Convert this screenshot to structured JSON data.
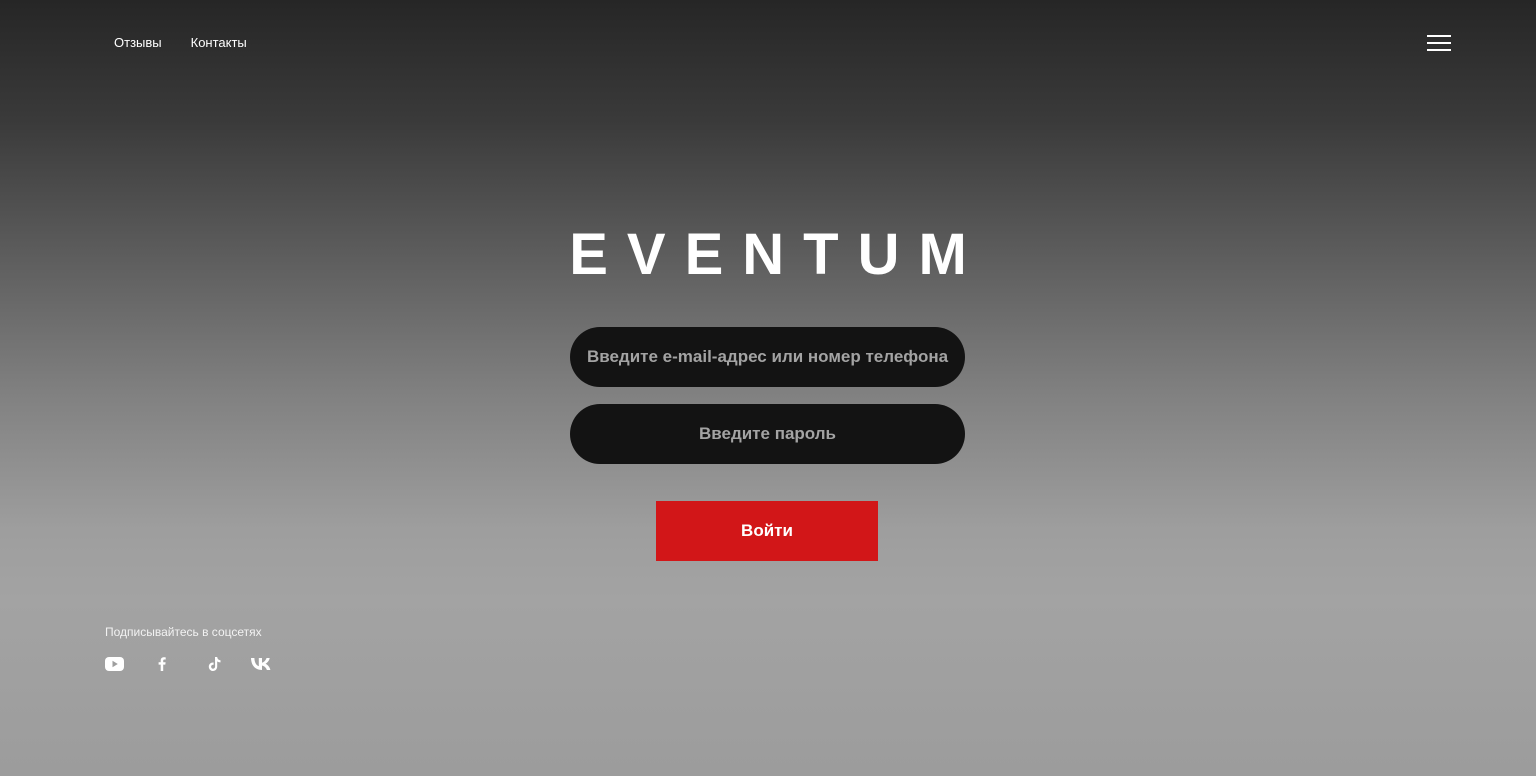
{
  "nav": {
    "links": [
      "Отзывы",
      "Контакты"
    ]
  },
  "menu": {
    "icon": "hamburger-menu-icon"
  },
  "brand": {
    "logo_text": "EVENTUM"
  },
  "login_form": {
    "email_placeholder": "Введите e-mail-адрес или номер телефона",
    "password_placeholder": "Введите пароль",
    "submit_label": "Войти",
    "submit_color": "#d21618",
    "field_color": "#131313"
  },
  "social": {
    "title": "Подписывайтесь в соцсетях",
    "icons": [
      "youtube-icon",
      "facebook-icon",
      "tiktok-icon",
      "vk-icon"
    ]
  }
}
